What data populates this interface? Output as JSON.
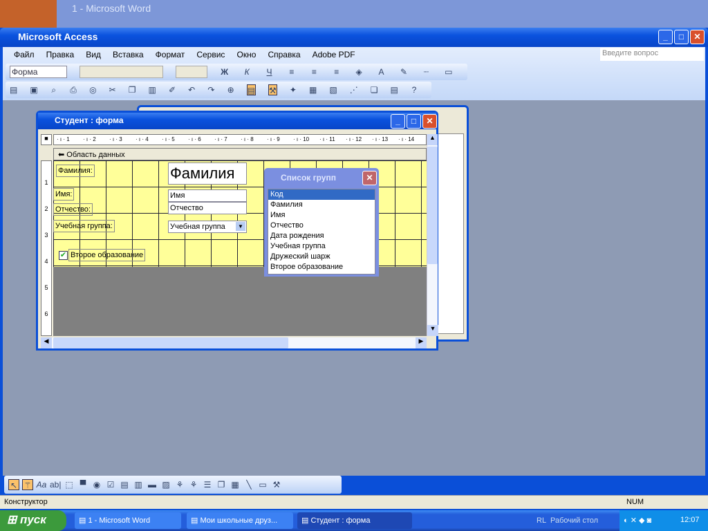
{
  "word": {
    "title": "1 - Microsoft Word",
    "ask": "Введите вопрос"
  },
  "access": {
    "title": "Microsoft Access",
    "menu": [
      "Файл",
      "Правка",
      "Вид",
      "Вставка",
      "Формат",
      "Сервис",
      "Окно",
      "Справка",
      "Adobe PDF"
    ],
    "ask_placeholder": "Введите вопрос",
    "object_combo": "Форма"
  },
  "form": {
    "title": "Студент : форма",
    "section": "Область данных",
    "ruler": [
      "1",
      "2",
      "3",
      "4",
      "5",
      "6",
      "7",
      "8",
      "9",
      "10",
      "11",
      "12",
      "13",
      "14"
    ],
    "vruler": [
      "1",
      "2",
      "3",
      "4",
      "5",
      "6"
    ],
    "labels": {
      "surname": "Фамилия:",
      "name": "Имя:",
      "patronymic": "Отчество:",
      "group": "Учебная группа:",
      "second": "Второе образование"
    },
    "fields": {
      "surname": "Фамилия",
      "name": "Имя",
      "patronymic": "Отчество",
      "group": "Учебная группа"
    },
    "second_checked": true
  },
  "field_list": {
    "title": "Список групп",
    "items": [
      "Код",
      "Фамилия",
      "Имя",
      "Отчество",
      "Дата рождения",
      "Учебная группа",
      "Дружеский шарж",
      "Второе образование"
    ],
    "selected": "Код"
  },
  "status": {
    "mode": "Конструктор",
    "num": "NUM"
  },
  "taskbar": {
    "start": "пуск",
    "tasks": [
      "1 - Microsoft Word",
      "Мои школьные друз...",
      "Студент : форма"
    ],
    "lang": "RL",
    "desktop": "Рабочий стол",
    "time": "12:07"
  }
}
